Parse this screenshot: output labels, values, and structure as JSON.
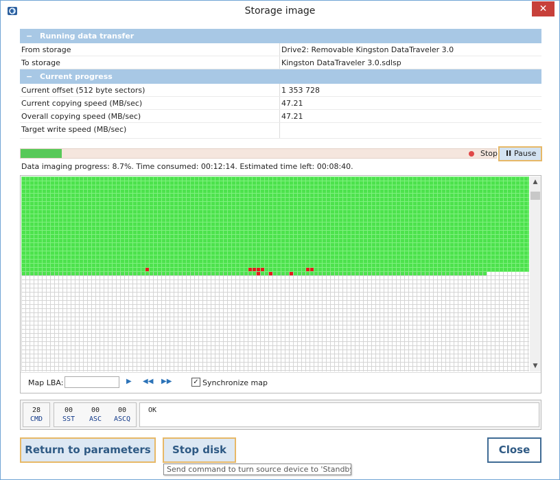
{
  "window": {
    "title": "Storage image",
    "close_glyph": "✕"
  },
  "sections": [
    {
      "title": "Running data transfer",
      "rows": [
        {
          "key": "From storage",
          "value": "Drive2: Removable Kingston DataTraveler 3.0"
        },
        {
          "key": "To storage",
          "value": "Kingston DataTraveler 3.0.sdlsp"
        }
      ]
    },
    {
      "title": "Current progress",
      "rows": [
        {
          "key": "Current offset (512 byte sectors)",
          "value": "1 353 728"
        },
        {
          "key": "Current copying speed (MB/sec)",
          "value": "47.21"
        },
        {
          "key": "Overall copying speed (MB/sec)",
          "value": "47.21"
        },
        {
          "key": "Target write speed (MB/sec)",
          "value": ""
        }
      ]
    }
  ],
  "progress": {
    "percent": 8.7,
    "stop_label": "Stop",
    "pause_label": "Pause",
    "status_text": "Data imaging progress: 8.7%. Time consumed: 00:12:14. Estimated time left: 00:08:40."
  },
  "map": {
    "lba_label": "Map LBA:",
    "lba_value": "",
    "sync_label": "Synchronize map",
    "sync_checked": true,
    "colors": {
      "ok": "#4de24d",
      "bad": "#e31b1b",
      "empty": "#ffffff",
      "grid": "#c9c9c9"
    }
  },
  "registers": {
    "cmd": {
      "value": "28",
      "name": "CMD"
    },
    "sst": {
      "value": "00",
      "name": "SST"
    },
    "asc": {
      "value": "00",
      "name": "ASC"
    },
    "ascq": {
      "value": "00",
      "name": "ASCQ"
    },
    "status": "OK"
  },
  "buttons": {
    "return_label": "Return to parameters",
    "stop_disk_label": "Stop disk",
    "close_label": "Close",
    "tooltip": "Send command to turn source device to 'Standby' state"
  }
}
